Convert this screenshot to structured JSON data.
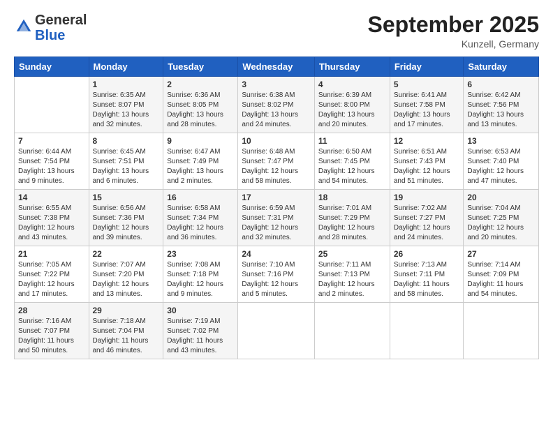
{
  "header": {
    "logo_general": "General",
    "logo_blue": "Blue",
    "month_title": "September 2025",
    "location": "Kunzell, Germany"
  },
  "days_of_week": [
    "Sunday",
    "Monday",
    "Tuesday",
    "Wednesday",
    "Thursday",
    "Friday",
    "Saturday"
  ],
  "weeks": [
    [
      {
        "day": "",
        "content": ""
      },
      {
        "day": "1",
        "content": "Sunrise: 6:35 AM\nSunset: 8:07 PM\nDaylight: 13 hours\nand 32 minutes."
      },
      {
        "day": "2",
        "content": "Sunrise: 6:36 AM\nSunset: 8:05 PM\nDaylight: 13 hours\nand 28 minutes."
      },
      {
        "day": "3",
        "content": "Sunrise: 6:38 AM\nSunset: 8:02 PM\nDaylight: 13 hours\nand 24 minutes."
      },
      {
        "day": "4",
        "content": "Sunrise: 6:39 AM\nSunset: 8:00 PM\nDaylight: 13 hours\nand 20 minutes."
      },
      {
        "day": "5",
        "content": "Sunrise: 6:41 AM\nSunset: 7:58 PM\nDaylight: 13 hours\nand 17 minutes."
      },
      {
        "day": "6",
        "content": "Sunrise: 6:42 AM\nSunset: 7:56 PM\nDaylight: 13 hours\nand 13 minutes."
      }
    ],
    [
      {
        "day": "7",
        "content": "Sunrise: 6:44 AM\nSunset: 7:54 PM\nDaylight: 13 hours\nand 9 minutes."
      },
      {
        "day": "8",
        "content": "Sunrise: 6:45 AM\nSunset: 7:51 PM\nDaylight: 13 hours\nand 6 minutes."
      },
      {
        "day": "9",
        "content": "Sunrise: 6:47 AM\nSunset: 7:49 PM\nDaylight: 13 hours\nand 2 minutes."
      },
      {
        "day": "10",
        "content": "Sunrise: 6:48 AM\nSunset: 7:47 PM\nDaylight: 12 hours\nand 58 minutes."
      },
      {
        "day": "11",
        "content": "Sunrise: 6:50 AM\nSunset: 7:45 PM\nDaylight: 12 hours\nand 54 minutes."
      },
      {
        "day": "12",
        "content": "Sunrise: 6:51 AM\nSunset: 7:43 PM\nDaylight: 12 hours\nand 51 minutes."
      },
      {
        "day": "13",
        "content": "Sunrise: 6:53 AM\nSunset: 7:40 PM\nDaylight: 12 hours\nand 47 minutes."
      }
    ],
    [
      {
        "day": "14",
        "content": "Sunrise: 6:55 AM\nSunset: 7:38 PM\nDaylight: 12 hours\nand 43 minutes."
      },
      {
        "day": "15",
        "content": "Sunrise: 6:56 AM\nSunset: 7:36 PM\nDaylight: 12 hours\nand 39 minutes."
      },
      {
        "day": "16",
        "content": "Sunrise: 6:58 AM\nSunset: 7:34 PM\nDaylight: 12 hours\nand 36 minutes."
      },
      {
        "day": "17",
        "content": "Sunrise: 6:59 AM\nSunset: 7:31 PM\nDaylight: 12 hours\nand 32 minutes."
      },
      {
        "day": "18",
        "content": "Sunrise: 7:01 AM\nSunset: 7:29 PM\nDaylight: 12 hours\nand 28 minutes."
      },
      {
        "day": "19",
        "content": "Sunrise: 7:02 AM\nSunset: 7:27 PM\nDaylight: 12 hours\nand 24 minutes."
      },
      {
        "day": "20",
        "content": "Sunrise: 7:04 AM\nSunset: 7:25 PM\nDaylight: 12 hours\nand 20 minutes."
      }
    ],
    [
      {
        "day": "21",
        "content": "Sunrise: 7:05 AM\nSunset: 7:22 PM\nDaylight: 12 hours\nand 17 minutes."
      },
      {
        "day": "22",
        "content": "Sunrise: 7:07 AM\nSunset: 7:20 PM\nDaylight: 12 hours\nand 13 minutes."
      },
      {
        "day": "23",
        "content": "Sunrise: 7:08 AM\nSunset: 7:18 PM\nDaylight: 12 hours\nand 9 minutes."
      },
      {
        "day": "24",
        "content": "Sunrise: 7:10 AM\nSunset: 7:16 PM\nDaylight: 12 hours\nand 5 minutes."
      },
      {
        "day": "25",
        "content": "Sunrise: 7:11 AM\nSunset: 7:13 PM\nDaylight: 12 hours\nand 2 minutes."
      },
      {
        "day": "26",
        "content": "Sunrise: 7:13 AM\nSunset: 7:11 PM\nDaylight: 11 hours\nand 58 minutes."
      },
      {
        "day": "27",
        "content": "Sunrise: 7:14 AM\nSunset: 7:09 PM\nDaylight: 11 hours\nand 54 minutes."
      }
    ],
    [
      {
        "day": "28",
        "content": "Sunrise: 7:16 AM\nSunset: 7:07 PM\nDaylight: 11 hours\nand 50 minutes."
      },
      {
        "day": "29",
        "content": "Sunrise: 7:18 AM\nSunset: 7:04 PM\nDaylight: 11 hours\nand 46 minutes."
      },
      {
        "day": "30",
        "content": "Sunrise: 7:19 AM\nSunset: 7:02 PM\nDaylight: 11 hours\nand 43 minutes."
      },
      {
        "day": "",
        "content": ""
      },
      {
        "day": "",
        "content": ""
      },
      {
        "day": "",
        "content": ""
      },
      {
        "day": "",
        "content": ""
      }
    ]
  ]
}
